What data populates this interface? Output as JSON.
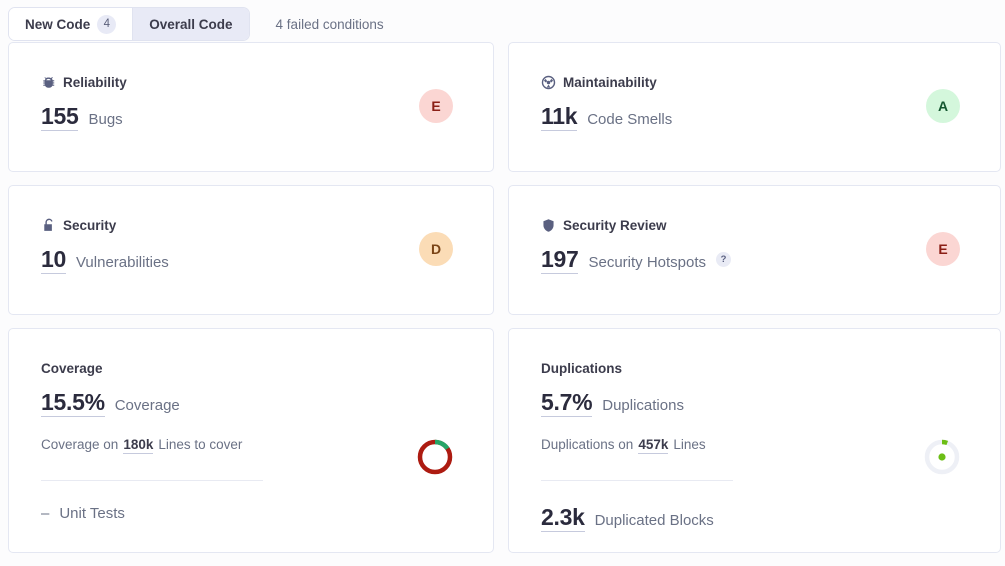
{
  "tabs": [
    {
      "label": "New Code",
      "badge": "4",
      "selected": false,
      "name": "tab-new-code"
    },
    {
      "label": "Overall Code",
      "badge": null,
      "selected": true,
      "name": "tab-overall-code"
    }
  ],
  "failed_conditions": "4 failed conditions",
  "cards": {
    "reliability": {
      "title": "Reliability",
      "icon": "bug-icon",
      "value": "155",
      "label": "Bugs",
      "rating": "E",
      "rating_bg": "#fbd6d3",
      "rating_fg": "#8b1f16"
    },
    "maintainability": {
      "title": "Maintainability",
      "icon": "code-smell-icon",
      "value": "11k",
      "label": "Code Smells",
      "rating": "A",
      "rating_bg": "#d4f7dc",
      "rating_fg": "#14562f"
    },
    "security": {
      "title": "Security",
      "icon": "open-lock-icon",
      "value": "10",
      "label": "Vulnerabilities",
      "rating": "D",
      "rating_bg": "#fbdcb6",
      "rating_fg": "#7a4416"
    },
    "security_review": {
      "title": "Security Review",
      "icon": "shield-icon",
      "value": "197",
      "label": "Security Hotspots",
      "help": "?",
      "rating": "E",
      "rating_bg": "#fbd6d3",
      "rating_fg": "#8b1f16"
    },
    "coverage": {
      "title": "Coverage",
      "value": "15.5%",
      "label": "Coverage",
      "sub_prefix": "Coverage on",
      "sub_value": "180k",
      "sub_suffix": "Lines to cover",
      "foot_dash": "–",
      "foot_label": "Unit Tests",
      "donut": {
        "percent": 15.5,
        "fill_color": "#27a567",
        "track_color": "#ad1b11"
      }
    },
    "duplications": {
      "title": "Duplications",
      "value": "5.7%",
      "label": "Duplications",
      "sub_prefix": "Duplications on",
      "sub_value": "457k",
      "sub_suffix": "Lines",
      "foot_value": "2.3k",
      "foot_label": "Duplicated Blocks",
      "donut": {
        "percent": 5.7,
        "fill_color": "#6cbe15",
        "track_color": "#eef0f6",
        "center_dot_color": "#6cbe15"
      }
    }
  }
}
